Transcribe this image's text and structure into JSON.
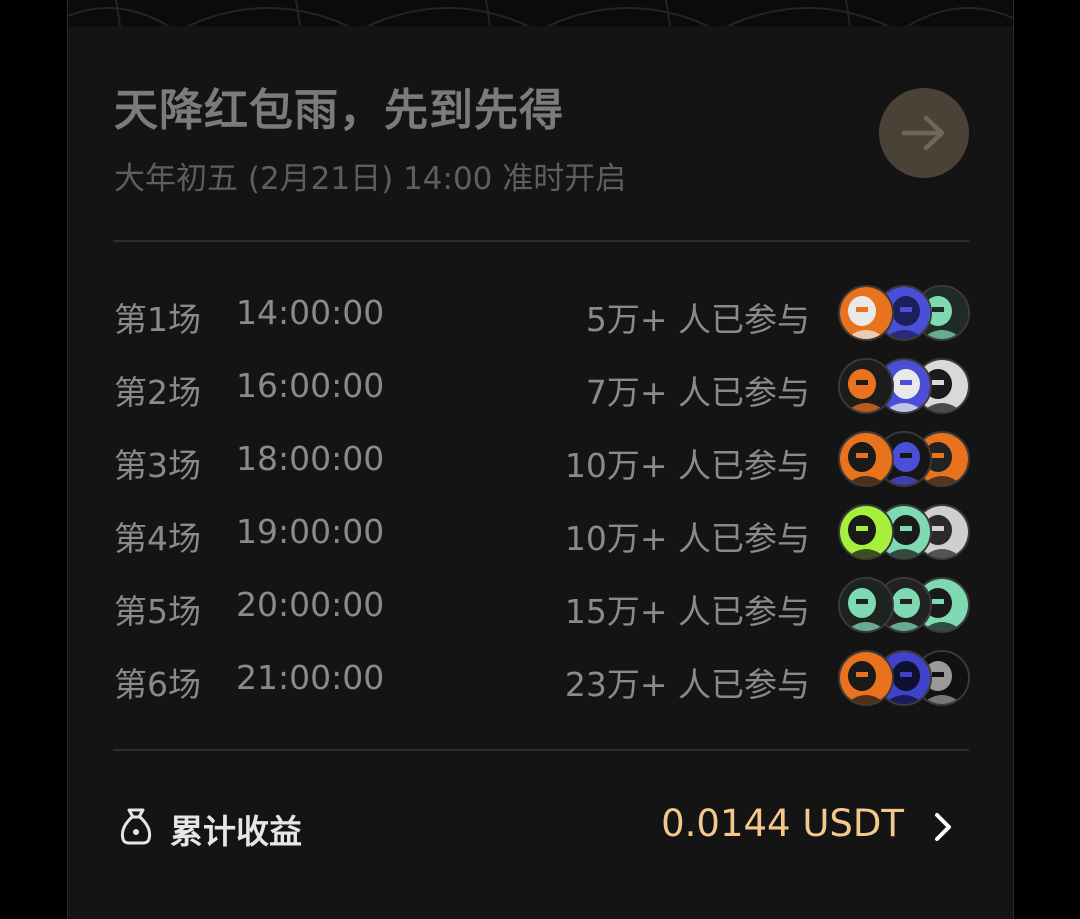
{
  "header": {
    "title": "天降红包雨，先到先得",
    "subtitle": "大年初五 (2月21日) 14:00 准时开启",
    "arrow_icon": "arrow-right-icon"
  },
  "sessions": [
    {
      "name": "第1场",
      "time": "14:00:00",
      "participants": "5万+ 人已参与",
      "avatars": [
        {
          "bg": "#e8731c",
          "fg": "#e9e9e9"
        },
        {
          "bg": "#4b4fd8",
          "fg": "#1d1f5a"
        },
        {
          "bg": "#1f2b26",
          "fg": "#7fd9b3"
        }
      ]
    },
    {
      "name": "第2场",
      "time": "16:00:00",
      "participants": "7万+ 人已参与",
      "avatars": [
        {
          "bg": "#1c1c1c",
          "fg": "#e8731c"
        },
        {
          "bg": "#4b4fd8",
          "fg": "#e9e9e9"
        },
        {
          "bg": "#d9d9d9",
          "fg": "#1a1a1a"
        }
      ]
    },
    {
      "name": "第3场",
      "time": "18:00:00",
      "participants": "10万+ 人已参与",
      "avatars": [
        {
          "bg": "#e8731c",
          "fg": "#1a1a1a"
        },
        {
          "bg": "#161616",
          "fg": "#4b4fd8"
        },
        {
          "bg": "#e8731c",
          "fg": "#222222"
        }
      ]
    },
    {
      "name": "第4场",
      "time": "19:00:00",
      "participants": "10万+ 人已参与",
      "avatars": [
        {
          "bg": "#a6f03c",
          "fg": "#1a1a1a"
        },
        {
          "bg": "#7fd9b3",
          "fg": "#1a1a1a"
        },
        {
          "bg": "#cfcfcf",
          "fg": "#2a2a2a"
        }
      ]
    },
    {
      "name": "第5场",
      "time": "20:00:00",
      "participants": "15万+ 人已参与",
      "avatars": [
        {
          "bg": "#1c2420",
          "fg": "#7fd9b3"
        },
        {
          "bg": "#222222",
          "fg": "#7fd9b3"
        },
        {
          "bg": "#7fd9b3",
          "fg": "#1a1a1a"
        }
      ]
    },
    {
      "name": "第6场",
      "time": "21:00:00",
      "participants": "23万+ 人已参与",
      "avatars": [
        {
          "bg": "#e8731c",
          "fg": "#1a1a1a"
        },
        {
          "bg": "#3f43c9",
          "fg": "#0f1030"
        },
        {
          "bg": "#111111",
          "fg": "#9a9a9a"
        }
      ]
    }
  ],
  "footer": {
    "label": "累计收益",
    "value": "0.0144 USDT",
    "bag_icon": "money-bag-icon",
    "chevron_icon": "chevron-right-icon"
  },
  "colors": {
    "background": "#141414",
    "accent_gold": "#f3c98b",
    "arrow_button": "#4a4237"
  }
}
